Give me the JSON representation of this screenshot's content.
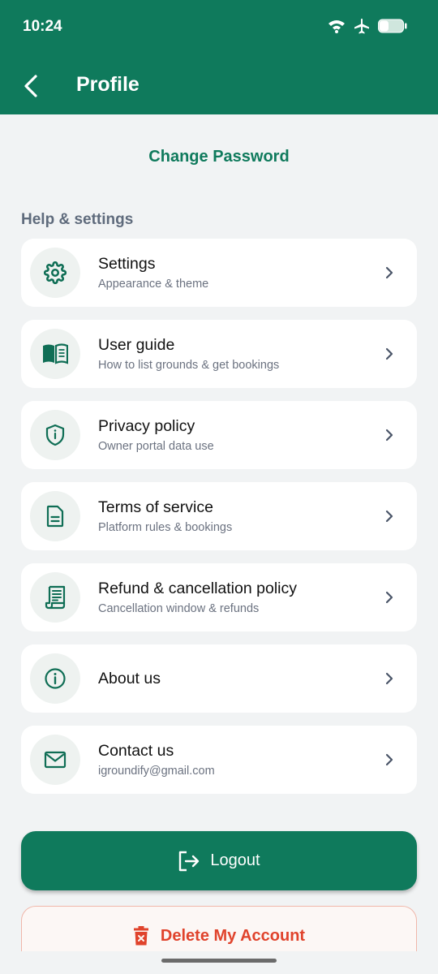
{
  "status_bar": {
    "time": "10:24",
    "icons": [
      "wifi-icon",
      "airplane-mode-icon",
      "battery-icon"
    ]
  },
  "header": {
    "title": "Profile",
    "back_icon": "chevron-left-icon"
  },
  "change_password_label": "Change Password",
  "help_section": {
    "title": "Help & settings",
    "items": [
      {
        "title": "Settings",
        "subtitle": "Appearance & theme",
        "icon": "gear-icon"
      },
      {
        "title": "User guide",
        "subtitle": "How to list grounds & get bookings",
        "icon": "book-icon"
      },
      {
        "title": "Privacy policy",
        "subtitle": "Owner portal data use",
        "icon": "shield-icon"
      },
      {
        "title": "Terms of service",
        "subtitle": "Platform rules & bookings",
        "icon": "document-icon"
      },
      {
        "title": "Refund & cancellation policy",
        "subtitle": "Cancellation window & refunds",
        "icon": "receipt-icon"
      },
      {
        "title": "About us",
        "subtitle": "",
        "icon": "info-icon"
      },
      {
        "title": "Contact us",
        "subtitle": "igroundify@gmail.com",
        "icon": "mail-icon"
      }
    ]
  },
  "actions": {
    "logout_label": "Logout",
    "delete_label": "Delete My Account"
  },
  "colors": {
    "primary": "#0f7a5c",
    "danger": "#e0432c",
    "background": "#f1f3f4"
  }
}
